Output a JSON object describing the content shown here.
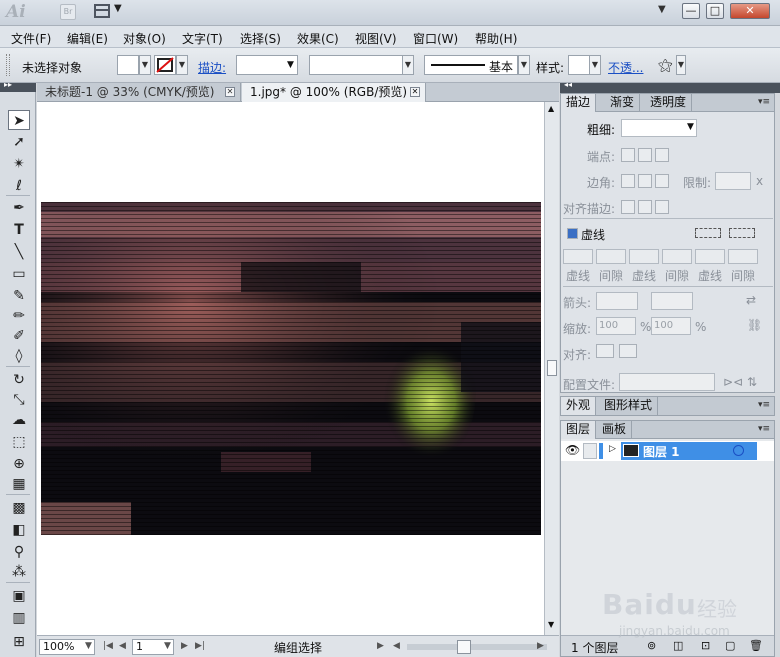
{
  "window": {
    "app_logo": "Ai",
    "bridge_label": "Br",
    "minimize": "—",
    "maximize": "□",
    "close": "✕",
    "workspace_menu": "▼"
  },
  "menubar": [
    "文件(F)",
    "编辑(E)",
    "对象(O)",
    "文字(T)",
    "选择(S)",
    "效果(C)",
    "视图(V)",
    "窗口(W)",
    "帮助(H)"
  ],
  "control_bar": {
    "selection_status": "未选择对象",
    "stroke_label": "描边:",
    "stroke_profile": "基本",
    "style_label": "样式:",
    "opacity_label": "不透..."
  },
  "document_tabs": [
    {
      "title": "未标题-1 @ 33% (CMYK/预览)",
      "active": false
    },
    {
      "title": "1.jpg* @ 100% (RGB/预览)",
      "active": true
    }
  ],
  "statusbar": {
    "zoom": "100%",
    "artboard": "1",
    "status": "编组选择"
  },
  "stroke_panel": {
    "tabs": [
      "描边",
      "渐变",
      "透明度"
    ],
    "weight_label": "粗细:",
    "cap_label": "端点:",
    "corner_label": "边角:",
    "limit_label": "限制:",
    "limit_x": "x",
    "align_label": "对齐描边:",
    "dashed_label": "虚线",
    "dash_labels": [
      "虚线",
      "间隙",
      "虚线",
      "间隙",
      "虚线",
      "间隙"
    ],
    "arrow_label": "箭头:",
    "scale_label": "缩放:",
    "scale_values": [
      "100",
      "100"
    ],
    "percent": "%",
    "align2_label": "对齐:",
    "profile_label": "配置文件:"
  },
  "appearance_panel": {
    "tabs": [
      "外观",
      "图形样式"
    ]
  },
  "layers_panel": {
    "tabs": [
      "图层",
      "画板"
    ],
    "layers": [
      {
        "name": "图层 1",
        "selected": true
      }
    ],
    "count": "1 个图层"
  },
  "watermark": {
    "logo": "Baidu",
    "cn": "经验",
    "url": "jingyan.baidu.com"
  },
  "colors": {
    "accent": "#3f8fe6",
    "panel_bg": "#dfe3e8",
    "dark_strip": "#4a525c"
  }
}
